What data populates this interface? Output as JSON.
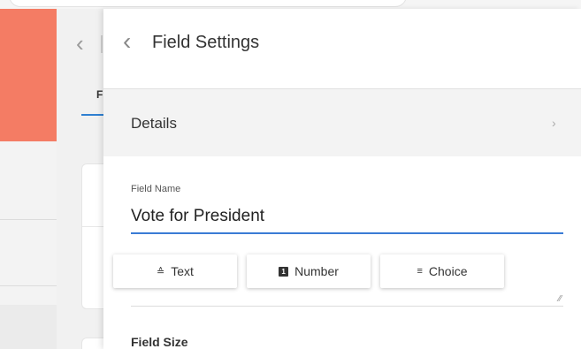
{
  "panel": {
    "title": "Field Settings"
  },
  "middle_panel": {
    "tab_initial": "F"
  },
  "details": {
    "label": "Details",
    "chevron": "›"
  },
  "field_name": {
    "label": "Field Name",
    "value": "Vote for President"
  },
  "field_types": [
    {
      "label": "Text",
      "icon": "text-format-icon",
      "glyph": "≙"
    },
    {
      "label": "Number",
      "icon": "number-icon",
      "glyph": "1"
    },
    {
      "label": "Choice",
      "icon": "list-icon",
      "glyph": "≡"
    }
  ],
  "field_size": {
    "label": "Field Size"
  },
  "colors": {
    "accent": "#3a7bd5",
    "brand": "#f47c64"
  }
}
